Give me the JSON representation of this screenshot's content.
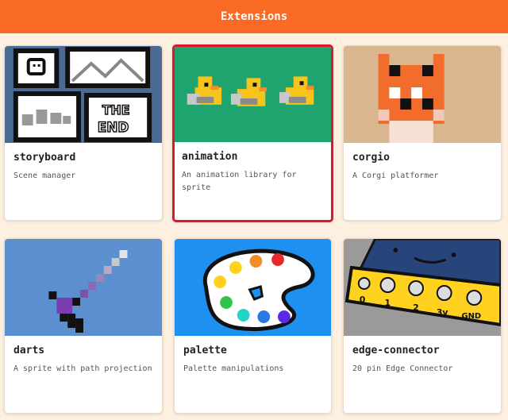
{
  "header": {
    "title": "Extensions"
  },
  "cards": [
    {
      "title": "storyboard",
      "description": "Scene manager",
      "icon": "storyboard-comic-icon"
    },
    {
      "title": "animation",
      "description": "An animation library for sprite",
      "icon": "ducks-animation-icon"
    },
    {
      "title": "corgio",
      "description": "A Corgi platformer",
      "icon": "corgi-pixel-icon"
    },
    {
      "title": "darts",
      "description": "A sprite with path projection",
      "icon": "dart-icon"
    },
    {
      "title": "palette",
      "description": "Palette manipulations",
      "icon": "paint-palette-icon"
    },
    {
      "title": "edge-connector",
      "description": "20 pin Edge Connector",
      "icon": "edge-connector-board-icon"
    }
  ],
  "storyboard_thumb": {
    "end_text_1": "THE",
    "end_text_2": "END"
  },
  "edge_thumb": {
    "pins": [
      "0",
      "1",
      "2",
      "3v",
      "GND"
    ]
  },
  "colors": {
    "header": "#f96b24",
    "selection": "#d91a2a",
    "background": "#fdf0e0"
  }
}
